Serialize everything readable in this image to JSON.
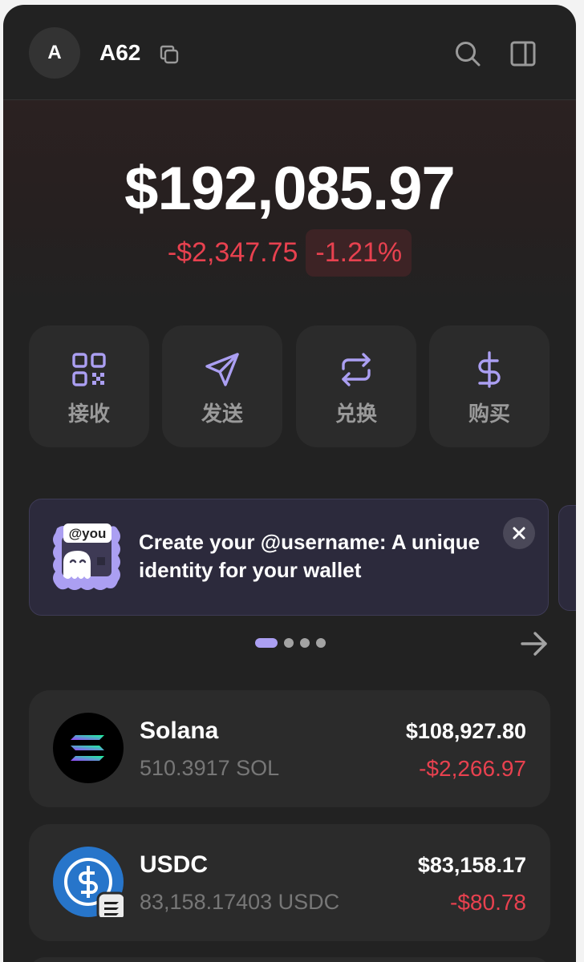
{
  "account": {
    "avatar_letter": "A",
    "name": "A62"
  },
  "header_icons": [
    "copy-icon",
    "search-icon",
    "panel-toggle-icon"
  ],
  "balance": {
    "total": "$192,085.97",
    "change_amount": "-$2,347.75",
    "change_percent": "-1.21%"
  },
  "actions": [
    {
      "label": "接收",
      "icon": "qr-code-icon"
    },
    {
      "label": "发送",
      "icon": "send-icon"
    },
    {
      "label": "兑换",
      "icon": "swap-icon"
    },
    {
      "label": "购买",
      "icon": "dollar-icon"
    }
  ],
  "banner": {
    "tag": "@you",
    "text": "Create your @username: A unique identity for your wallet",
    "page_count": 4,
    "active_page": 1
  },
  "tokens": [
    {
      "name": "Solana",
      "amount": "510.3917 SOL",
      "value": "$108,927.80",
      "change": "-$2,266.97"
    },
    {
      "name": "USDC",
      "amount": "83,158.17403 USDC",
      "value": "$83,158.17",
      "change": "-$80.78"
    }
  ],
  "colors": {
    "background": "#222222",
    "negative": "#e8414f",
    "accent": "#ab9ff2",
    "card": "#2b2b2b"
  }
}
